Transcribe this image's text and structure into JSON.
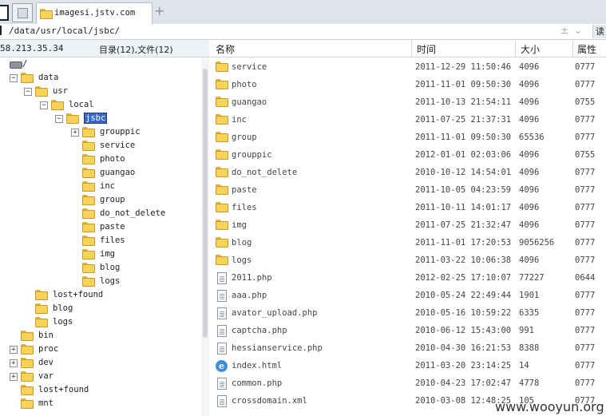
{
  "tab": {
    "title": "imagesi.jstv.com",
    "add_label": "+"
  },
  "address": {
    "path": "/data/usr/local/jsbc/",
    "go_label": "读"
  },
  "left_header": {
    "ip": "58.213.35.34",
    "summary": "目录(12),文件(12)"
  },
  "tree": [
    {
      "label": "/",
      "level": 0,
      "icon": "drive-icon",
      "toggle": ""
    },
    {
      "label": "data",
      "level": 1,
      "icon": "folder-icon",
      "toggle": "−"
    },
    {
      "label": "usr",
      "level": 2,
      "icon": "folder-icon",
      "toggle": "−"
    },
    {
      "label": "local",
      "level": 3,
      "icon": "folder-icon",
      "toggle": "−"
    },
    {
      "label": "jsbc",
      "level": 4,
      "icon": "folder-open-icon",
      "toggle": "−",
      "selected": true
    },
    {
      "label": "grouppic",
      "level": 5,
      "icon": "folder-icon",
      "toggle": "+"
    },
    {
      "label": "service",
      "level": 5,
      "icon": "folder-icon",
      "toggle": ""
    },
    {
      "label": "photo",
      "level": 5,
      "icon": "folder-icon",
      "toggle": ""
    },
    {
      "label": "guangao",
      "level": 5,
      "icon": "folder-icon",
      "toggle": ""
    },
    {
      "label": "inc",
      "level": 5,
      "icon": "folder-icon",
      "toggle": ""
    },
    {
      "label": "group",
      "level": 5,
      "icon": "folder-icon",
      "toggle": ""
    },
    {
      "label": "do_not_delete",
      "level": 5,
      "icon": "folder-icon",
      "toggle": ""
    },
    {
      "label": "paste",
      "level": 5,
      "icon": "folder-icon",
      "toggle": ""
    },
    {
      "label": "files",
      "level": 5,
      "icon": "folder-icon",
      "toggle": ""
    },
    {
      "label": "img",
      "level": 5,
      "icon": "folder-icon",
      "toggle": ""
    },
    {
      "label": "blog",
      "level": 5,
      "icon": "folder-icon",
      "toggle": ""
    },
    {
      "label": "logs",
      "level": 5,
      "icon": "folder-icon",
      "toggle": ""
    },
    {
      "label": "lost+found",
      "level": 2,
      "icon": "folder-icon",
      "toggle": ""
    },
    {
      "label": "blog",
      "level": 2,
      "icon": "folder-icon",
      "toggle": ""
    },
    {
      "label": "logs",
      "level": 2,
      "icon": "folder-icon",
      "toggle": ""
    },
    {
      "label": "bin",
      "level": 1,
      "icon": "folder-icon",
      "toggle": ""
    },
    {
      "label": "proc",
      "level": 1,
      "icon": "folder-icon",
      "toggle": "+"
    },
    {
      "label": "dev",
      "level": 1,
      "icon": "folder-icon",
      "toggle": "+"
    },
    {
      "label": "var",
      "level": 1,
      "icon": "folder-icon",
      "toggle": "+"
    },
    {
      "label": "lost+found",
      "level": 1,
      "icon": "folder-icon",
      "toggle": ""
    },
    {
      "label": "mnt",
      "level": 1,
      "icon": "folder-icon",
      "toggle": ""
    }
  ],
  "columns": {
    "name": "名称",
    "time": "时间",
    "size": "大小",
    "perm": "属性"
  },
  "files": [
    {
      "name": "service",
      "time": "2011-12-29 11:50:46",
      "size": "4096",
      "perm": "0777",
      "icon": "folder-icon"
    },
    {
      "name": "photo",
      "time": "2011-11-01 09:50:30",
      "size": "4096",
      "perm": "0777",
      "icon": "folder-icon"
    },
    {
      "name": "guangao",
      "time": "2011-10-13 21:54:11",
      "size": "4096",
      "perm": "0755",
      "icon": "folder-icon"
    },
    {
      "name": "inc",
      "time": "2011-07-25 21:37:31",
      "size": "4096",
      "perm": "0777",
      "icon": "folder-icon"
    },
    {
      "name": "group",
      "time": "2011-11-01 09:50:30",
      "size": "65536",
      "perm": "0777",
      "icon": "folder-icon"
    },
    {
      "name": "grouppic",
      "time": "2012-01-01 02:03:06",
      "size": "4096",
      "perm": "0755",
      "icon": "folder-icon"
    },
    {
      "name": "do_not_delete",
      "time": "2010-10-12 14:54:01",
      "size": "4096",
      "perm": "0777",
      "icon": "folder-icon"
    },
    {
      "name": "paste",
      "time": "2011-10-05 04:23:59",
      "size": "4096",
      "perm": "0777",
      "icon": "folder-icon"
    },
    {
      "name": "files",
      "time": "2011-10-11 14:01:17",
      "size": "4096",
      "perm": "0777",
      "icon": "folder-icon"
    },
    {
      "name": "img",
      "time": "2011-07-25 21:32:47",
      "size": "4096",
      "perm": "0777",
      "icon": "folder-icon"
    },
    {
      "name": "blog",
      "time": "2011-11-01 17:20:53",
      "size": "9056256",
      "perm": "0777",
      "icon": "folder-icon"
    },
    {
      "name": "logs",
      "time": "2011-03-22 10:06:38",
      "size": "4096",
      "perm": "0777",
      "icon": "folder-icon"
    },
    {
      "name": "2011.php",
      "time": "2012-02-25 17:10:07",
      "size": "77227",
      "perm": "0644",
      "icon": "file-icon"
    },
    {
      "name": "aaa.php",
      "time": "2010-05-24 22:49:44",
      "size": "1901",
      "perm": "0777",
      "icon": "file-icon"
    },
    {
      "name": "avator_upload.php",
      "time": "2010-05-16 10:59:22",
      "size": "6335",
      "perm": "0777",
      "icon": "file-icon"
    },
    {
      "name": "captcha.php",
      "time": "2010-06-12 15:43:00",
      "size": "991",
      "perm": "0777",
      "icon": "file-icon"
    },
    {
      "name": "hessianservice.php",
      "time": "2010-04-30 16:21:53",
      "size": "8388",
      "perm": "0777",
      "icon": "file-icon"
    },
    {
      "name": "index.html",
      "time": "2011-03-20 23:14:25",
      "size": "14",
      "perm": "0777",
      "icon": "html-icon"
    },
    {
      "name": "common.php",
      "time": "2010-04-23 17:02:47",
      "size": "4778",
      "perm": "0777",
      "icon": "file-icon"
    },
    {
      "name": "crossdomain.xml",
      "time": "2010-03-08 12:48:25",
      "size": "105",
      "perm": "0777",
      "icon": "file-icon"
    }
  ],
  "watermark": "www.wooyun.org"
}
